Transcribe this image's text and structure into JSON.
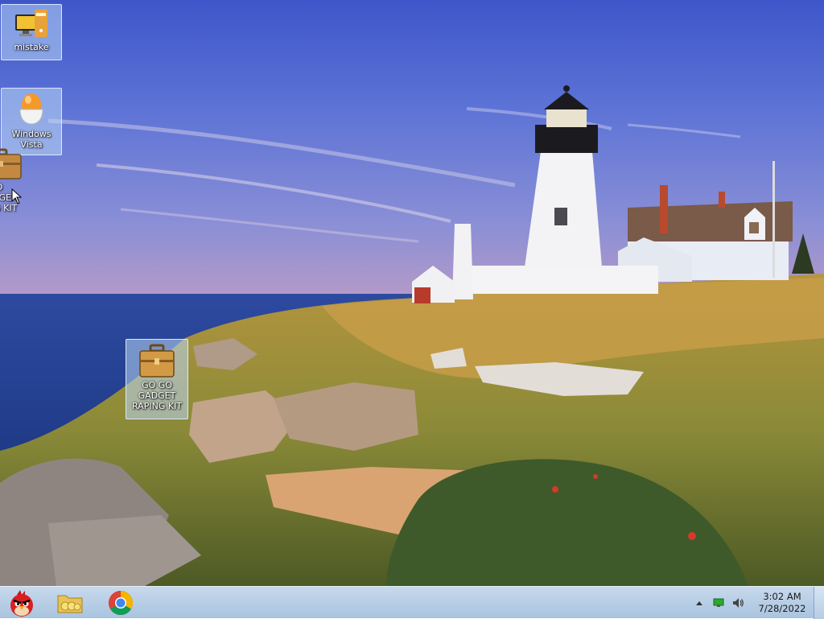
{
  "desktop": {
    "icons": [
      {
        "label": "mistake"
      },
      {
        "label": "Windows Vista"
      },
      {
        "label": "GO GO GADGET RAPING KIT"
      },
      {
        "label": "O GO GADGET PING KIT"
      }
    ]
  },
  "taskbar": {
    "pinned": [
      {
        "icon": "angry-bird-icon"
      },
      {
        "icon": "folder-icon"
      },
      {
        "icon": "chrome-icon"
      }
    ],
    "tray": {
      "icons": [
        "show-hidden-icons-arrow",
        "network-icon",
        "volume-icon"
      ],
      "time": "3:02 AM",
      "date": "7/28/2022"
    }
  },
  "colors": {
    "taskbar": "#b7cde6",
    "selection": "#b9d7f5",
    "sky": "#5a6fd0",
    "sea": "#2f4fa0"
  }
}
